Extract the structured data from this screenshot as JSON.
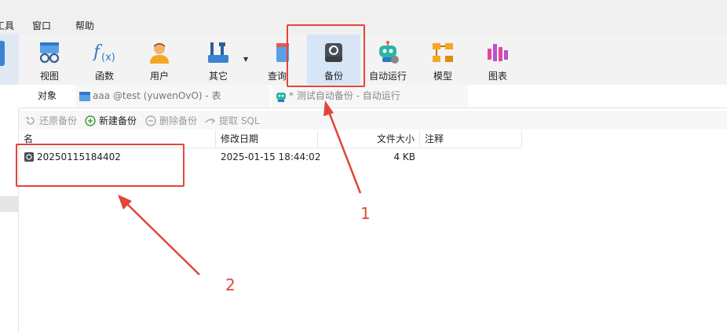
{
  "menu": {
    "tools_partial": "工具",
    "window": "窗口",
    "help": "帮助"
  },
  "ribbon": {
    "buttons": [
      {
        "label": "视图",
        "icon": "view-icon"
      },
      {
        "label": "函数",
        "icon": "function-icon"
      },
      {
        "label": "用户",
        "icon": "user-icon"
      },
      {
        "label": "其它",
        "icon": "tools-icon"
      },
      {
        "label": "查询",
        "icon": "query-icon"
      },
      {
        "label": "备份",
        "icon": "backup-icon"
      },
      {
        "label": "自动运行",
        "icon": "robot-icon"
      },
      {
        "label": "模型",
        "icon": "model-icon"
      },
      {
        "label": "图表",
        "icon": "chart-icon"
      }
    ],
    "active": "备份"
  },
  "tabs": {
    "objects": "对象",
    "table_tab": "aaa @test (yuwenOvO) - 表",
    "auto_tab": "* 测试自动备份 - 自动运行"
  },
  "toolbar": {
    "restore": "还原备份",
    "new": "新建备份",
    "delete": "删除备份",
    "extract": "提取 SQL"
  },
  "table": {
    "headers": {
      "name": "名",
      "modified": "修改日期",
      "size": "文件大小",
      "comment": "注释"
    },
    "rows": [
      {
        "name": "20250115184402",
        "modified": "2025-01-15 18:44:02",
        "size": "4 KB",
        "comment": ""
      }
    ]
  },
  "annotations": {
    "label1": "1",
    "label2": "2"
  },
  "colors": {
    "accent": "#3b83d3",
    "annotation_red": "#e2453c",
    "active_button": "#d7e6f7"
  }
}
